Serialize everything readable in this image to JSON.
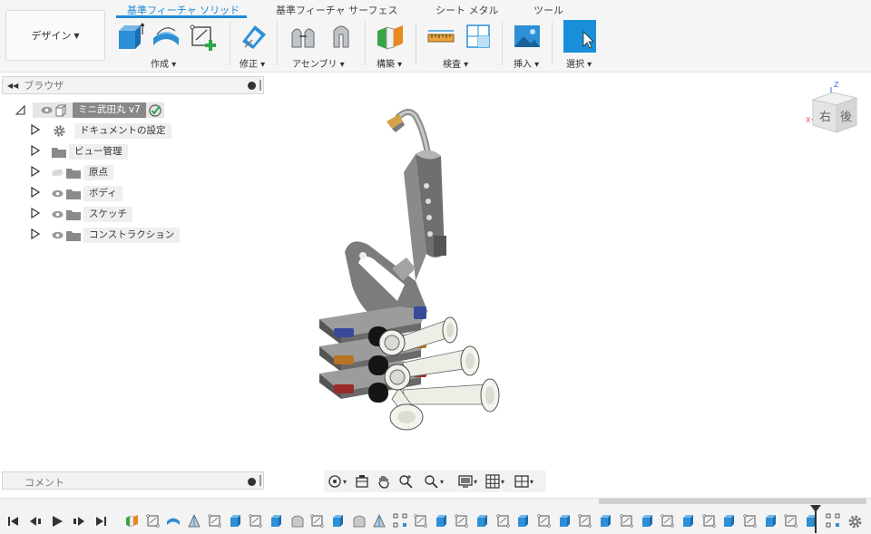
{
  "workspace": {
    "label": "デザイン"
  },
  "tabs": [
    {
      "label": "基準フィーチャ ソリッド",
      "active": true
    },
    {
      "label": "基準フィーチャ サーフェス",
      "active": false
    },
    {
      "label": "シート メタル",
      "active": false
    },
    {
      "label": "ツール",
      "active": false
    }
  ],
  "groups": {
    "create": "作成",
    "modify": "修正",
    "assemble": "アセンブリ",
    "construct": "構築",
    "inspect": "検査",
    "insert": "挿入",
    "select": "選択"
  },
  "toolbar_icons": [
    "extrude-icon",
    "revolve-icon",
    "create-sketch-icon",
    "press-pull-icon",
    "joint-icon",
    "as-built-joint-icon",
    "offset-plane-icon",
    "measure-icon",
    "section-analysis-icon",
    "insert-image-icon",
    "select-arrow-icon"
  ],
  "browser": {
    "title": "ブラウザ",
    "root": {
      "label": "ミニ武田丸 v7"
    },
    "items": [
      {
        "label": "ドキュメントの設定",
        "icon": "gear-icon"
      },
      {
        "label": "ビュー管理",
        "icon": "folder-icon"
      },
      {
        "label": "原点",
        "icon": "folder-icon"
      },
      {
        "label": "ボディ",
        "icon": "folder-icon"
      },
      {
        "label": "スケッチ",
        "icon": "folder-icon"
      },
      {
        "label": "コンストラクション",
        "icon": "folder-icon"
      }
    ]
  },
  "comments": {
    "label": "コメント"
  },
  "viewcube": {
    "right": "右",
    "back": "後",
    "axis_z": "Z",
    "axis_x": "X"
  },
  "colors": {
    "accent": "#1b8bd6",
    "select_bg": "#1a8fd9",
    "extrude": "#2d8fd6",
    "sketch_green": "#2aa84a"
  }
}
